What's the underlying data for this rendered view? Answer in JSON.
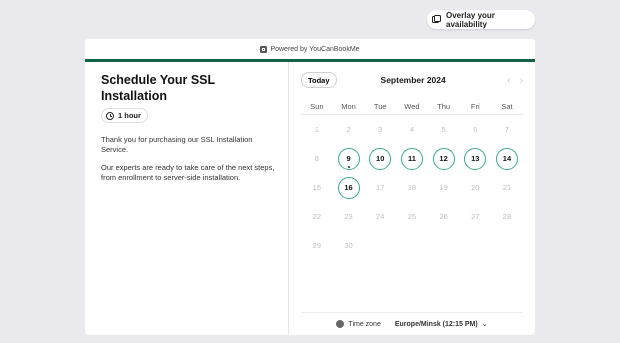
{
  "overlay_button": {
    "label": "Overlay your availability"
  },
  "powered_by": "Powered by YouCanBookMe",
  "colors": {
    "accent": "#14614a",
    "available_ring": "#3aa88c"
  },
  "event": {
    "title": "Schedule Your SSL Installation",
    "duration": "1 hour",
    "description": [
      "Thank you for purchasing our SSL Installation Service.",
      "Our experts are ready to take care of the next steps, from enrollment to server-side installation."
    ]
  },
  "calendar": {
    "today_label": "Today",
    "month_label": "September 2024",
    "prev_icon": "chevron-left-icon",
    "next_icon": "chevron-right-icon",
    "weekdays": [
      "Sun",
      "Mon",
      "Tue",
      "Wed",
      "Thu",
      "Fri",
      "Sat"
    ],
    "weeks": [
      [
        {
          "d": "1"
        },
        {
          "d": "2"
        },
        {
          "d": "3"
        },
        {
          "d": "4"
        },
        {
          "d": "5"
        },
        {
          "d": "6"
        },
        {
          "d": "7"
        }
      ],
      [
        {
          "d": "8"
        },
        {
          "d": "9",
          "avail": true,
          "today": true
        },
        {
          "d": "10",
          "avail": true
        },
        {
          "d": "11",
          "avail": true
        },
        {
          "d": "12",
          "avail": true
        },
        {
          "d": "13",
          "avail": true
        },
        {
          "d": "14",
          "avail": true
        }
      ],
      [
        {
          "d": "15"
        },
        {
          "d": "16",
          "avail": true
        },
        {
          "d": "17"
        },
        {
          "d": "18"
        },
        {
          "d": "19"
        },
        {
          "d": "20"
        },
        {
          "d": "21"
        }
      ],
      [
        {
          "d": "22"
        },
        {
          "d": "23"
        },
        {
          "d": "24"
        },
        {
          "d": "25"
        },
        {
          "d": "26"
        },
        {
          "d": "27"
        },
        {
          "d": "28"
        }
      ],
      [
        {
          "d": "29"
        },
        {
          "d": "30"
        }
      ]
    ]
  },
  "timezone": {
    "label": "Time zone",
    "value": "Europe/Minsk (12:15 PM)"
  }
}
